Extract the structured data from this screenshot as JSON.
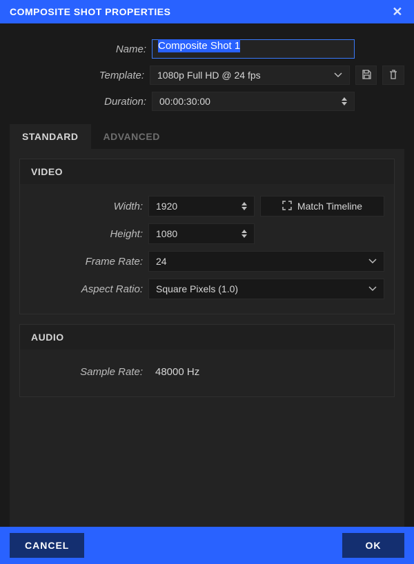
{
  "dialog": {
    "title": "COMPOSITE SHOT PROPERTIES"
  },
  "form": {
    "name_label": "Name:",
    "name_value": "Composite Shot 1",
    "template_label": "Template:",
    "template_value": "1080p Full HD @ 24 fps",
    "duration_label": "Duration:",
    "duration_value": "00:00:30:00"
  },
  "tabs": {
    "standard": "STANDARD",
    "advanced": "ADVANCED"
  },
  "video": {
    "header": "VIDEO",
    "width_label": "Width:",
    "width_value": "1920",
    "height_label": "Height:",
    "height_value": "1080",
    "match_timeline": "Match Timeline",
    "frame_rate_label": "Frame Rate:",
    "frame_rate_value": "24",
    "aspect_ratio_label": "Aspect Ratio:",
    "aspect_ratio_value": "Square Pixels (1.0)"
  },
  "audio": {
    "header": "AUDIO",
    "sample_rate_label": "Sample Rate:",
    "sample_rate_value": "48000 Hz"
  },
  "buttons": {
    "cancel": "CANCEL",
    "ok": "OK"
  }
}
